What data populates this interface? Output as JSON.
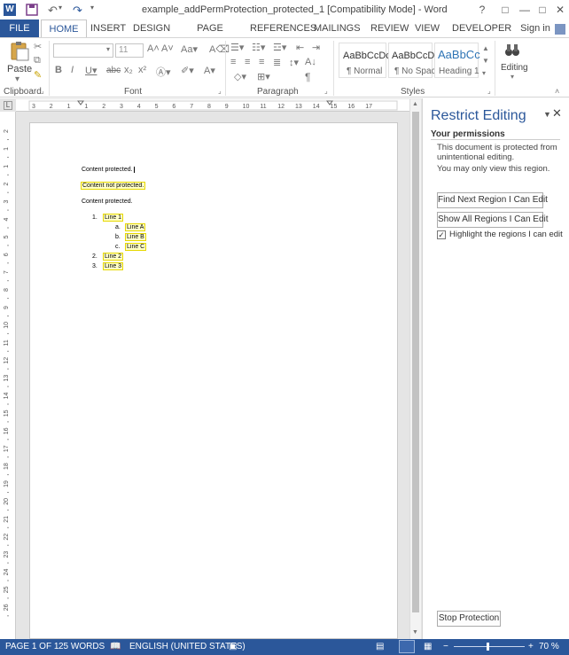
{
  "window": {
    "title": "example_addPermProtection_protected_1 [Compatibility Mode] - Word",
    "controls": {
      "help": "?",
      "ribbon_display": "□",
      "minimize": "—",
      "restore": "□",
      "close": "✕"
    }
  },
  "ribbon": {
    "tabs": [
      "FILE",
      "HOME",
      "INSERT",
      "DESIGN",
      "PAGE LAYOUT",
      "REFERENCES",
      "MAILINGS",
      "REVIEW",
      "VIEW",
      "DEVELOPER"
    ],
    "sign_in": "Sign in",
    "groups": {
      "clipboard": "Clipboard",
      "font": "Font",
      "paragraph": "Paragraph",
      "styles": "Styles"
    },
    "paste_label": "Paste",
    "font_size": "11",
    "styles": [
      {
        "preview": "AaBbCcDc",
        "name": "¶ Normal"
      },
      {
        "preview": "AaBbCcDc",
        "name": "¶ No Spac..."
      },
      {
        "preview": "AaBbCc",
        "name": "Heading 1"
      }
    ],
    "editing_label": "Editing"
  },
  "document": {
    "lines": [
      "Content protected.",
      "Content not protected.",
      "Content protected."
    ],
    "list": [
      {
        "num": "1.",
        "text": "Line 1"
      },
      {
        "num": "a.",
        "text": "Line A"
      },
      {
        "num": "b.",
        "text": "Line B"
      },
      {
        "num": "c.",
        "text": "Line C"
      },
      {
        "num": "2.",
        "text": "Line 2"
      },
      {
        "num": "3.",
        "text": "Line 3"
      }
    ],
    "hruler_labels": [
      "3",
      "2",
      "1",
      "1",
      "2",
      "3",
      "4",
      "5",
      "6",
      "7",
      "8",
      "9",
      "10",
      "11",
      "12",
      "13",
      "14",
      "15",
      "16",
      "17"
    ],
    "vruler_labels": [
      "2",
      "1",
      "1",
      "2",
      "3",
      "4",
      "5",
      "6",
      "7",
      "8",
      "9",
      "10",
      "11",
      "12",
      "13",
      "14",
      "15",
      "16",
      "17",
      "18",
      "19",
      "20",
      "21",
      "22",
      "23",
      "24",
      "25",
      "26"
    ]
  },
  "pane": {
    "title": "Restrict Editing",
    "permissions_heading": "Your permissions",
    "text1": "This document is protected from unintentional editing.",
    "text2": "You may only view this region.",
    "find_next": "Find Next Region I Can Edit",
    "show_all": "Show All Regions I Can Edit",
    "highlight_label": "Highlight the regions I can edit",
    "highlight_checked": true,
    "stop_protection": "Stop Protection"
  },
  "status": {
    "page": "PAGE 1 OF 1",
    "words": "25 WORDS",
    "language": "ENGLISH (UNITED STATES)",
    "zoom": "70 %",
    "zoom_level": 70
  },
  "colors": {
    "accent": "#2b579a",
    "pane_title": "#2b579a",
    "highlight": "#ffffc9"
  }
}
